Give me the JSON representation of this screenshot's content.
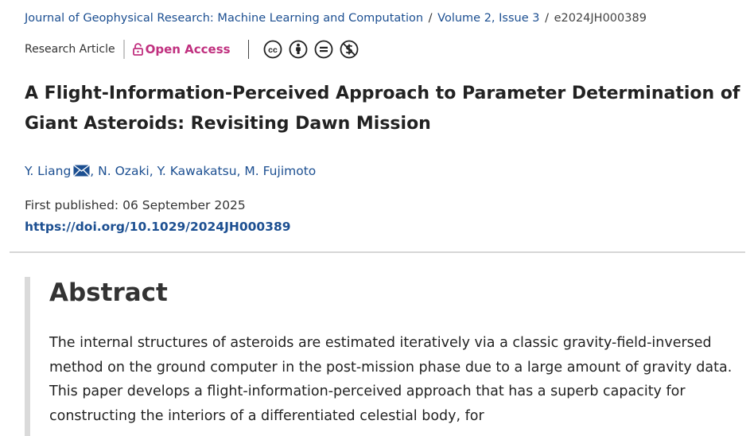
{
  "breadcrumb": {
    "journal": "Journal of Geophysical Research: Machine Learning and Computation",
    "sep1": "/",
    "issue": "Volume 2, Issue 3",
    "sep2": "/",
    "article_id": "e2024JH000389"
  },
  "meta": {
    "article_type": "Research Article",
    "access_label": "Open Access",
    "license_icons": [
      "creative-commons-icon",
      "attribution-icon",
      "no-derivatives-icon",
      "non-commercial-icon"
    ],
    "cc_text": "cc"
  },
  "article": {
    "title": "A Flight-Information-Perceived Approach to Parameter Determination of Giant Asteroids: Revisiting Dawn Mission",
    "authors": [
      "Y. Liang",
      "N. Ozaki",
      "Y. Kawakatsu",
      "M. Fujimoto"
    ],
    "author_sep": ", ",
    "published": "First published: 06 September 2025",
    "doi": "https://doi.org/10.1029/2024JH000389"
  },
  "abstract": {
    "heading": "Abstract",
    "text": "The internal structures of asteroids are estimated iteratively via a classic gravity-field-inversed method on the ground computer in the post-mission phase due to a large amount of gravity data. This paper develops a flight-information-perceived approach that has a superb capacity for constructing the interiors of a differentiated celestial body, for"
  },
  "colors": {
    "link": "#1c4f91",
    "open_access": "#c0307f",
    "text": "#222222",
    "divider": "#d6d6d6"
  }
}
